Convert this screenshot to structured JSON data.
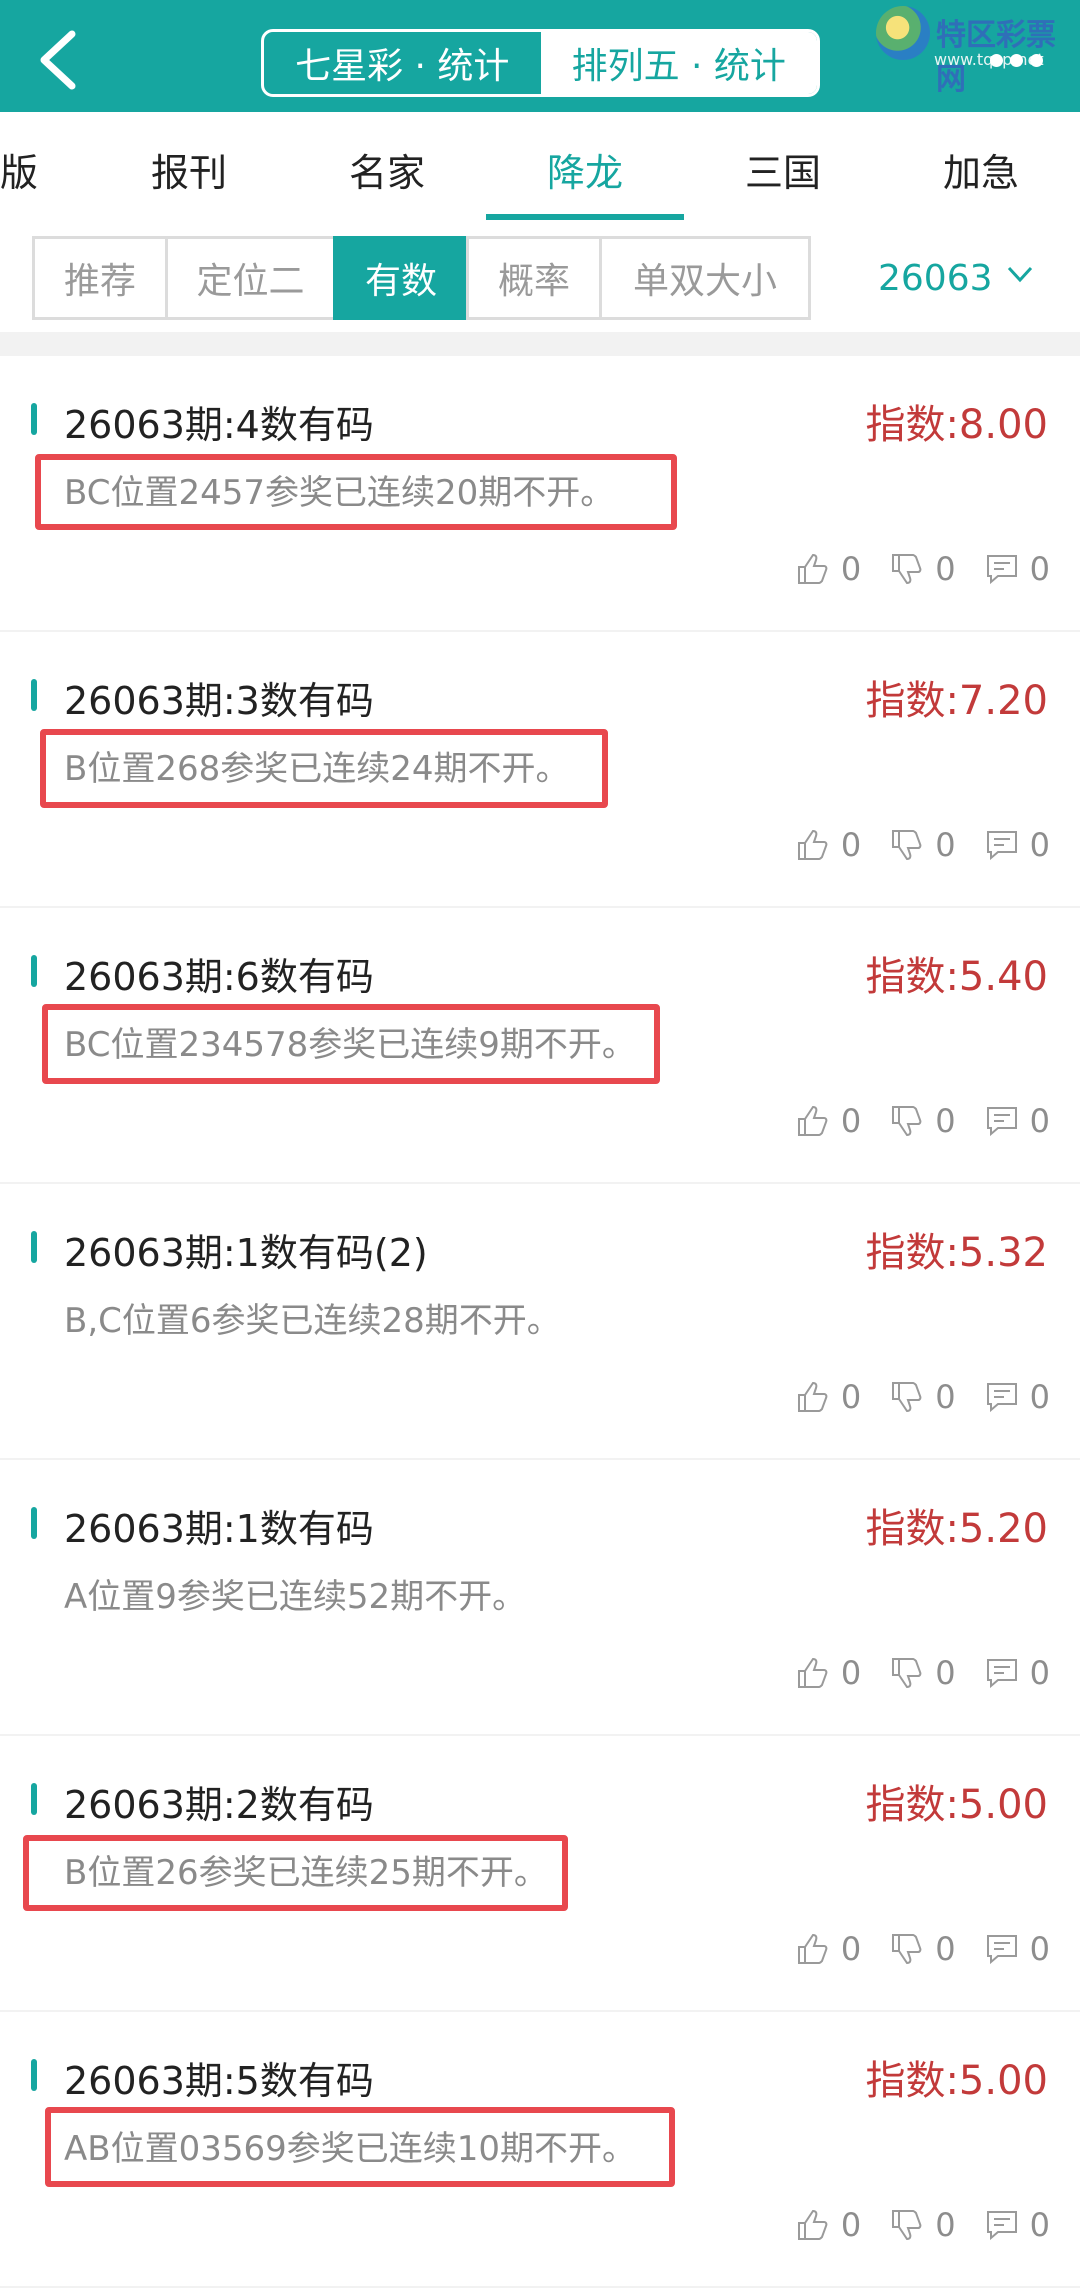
{
  "header": {
    "seg_stats_1": "七星彩 · 统计",
    "seg_stats_2": "排列五 · 统计",
    "logo_text": "特区彩票网",
    "logo_sub": "www.tqcp.net"
  },
  "tabs": [
    "版",
    "报刊",
    "名家",
    "降龙",
    "三国",
    "加急"
  ],
  "filters": [
    "推荐",
    "定位二",
    "有数",
    "概率",
    "单双大小"
  ],
  "period": "26063",
  "items": [
    {
      "title": "26063期:4数有码",
      "index": "指数:8.00",
      "desc": "BC位置2457参奖已连续20期不开。",
      "likes": "0",
      "dislikes": "0",
      "comments": "0"
    },
    {
      "title": "26063期:3数有码",
      "index": "指数:7.20",
      "desc": "B位置268参奖已连续24期不开。",
      "likes": "0",
      "dislikes": "0",
      "comments": "0"
    },
    {
      "title": "26063期:6数有码",
      "index": "指数:5.40",
      "desc": "BC位置234578参奖已连续9期不开。",
      "likes": "0",
      "dislikes": "0",
      "comments": "0"
    },
    {
      "title": "26063期:1数有码(2)",
      "index": "指数:5.32",
      "desc": "B,C位置6参奖已连续28期不开。",
      "likes": "0",
      "dislikes": "0",
      "comments": "0"
    },
    {
      "title": "26063期:1数有码",
      "index": "指数:5.20",
      "desc": "A位置9参奖已连续52期不开。",
      "likes": "0",
      "dislikes": "0",
      "comments": "0"
    },
    {
      "title": "26063期:2数有码",
      "index": "指数:5.00",
      "desc": "B位置26参奖已连续25期不开。",
      "likes": "0",
      "dislikes": "0",
      "comments": "0"
    },
    {
      "title": "26063期:5数有码",
      "index": "指数:5.00",
      "desc": "AB位置03569参奖已连续10期不开。",
      "likes": "0",
      "dislikes": "0",
      "comments": "0"
    }
  ]
}
